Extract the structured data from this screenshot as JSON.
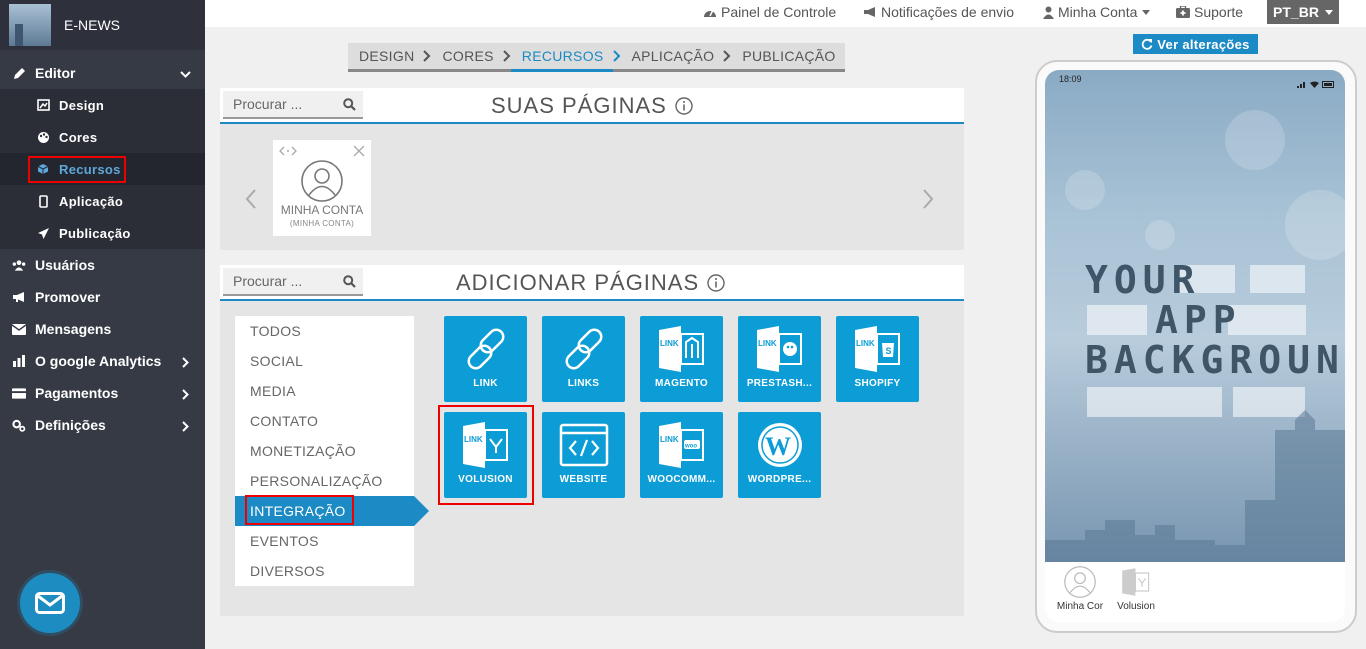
{
  "app": {
    "name": "E-NEWS"
  },
  "sidebar": {
    "items": [
      {
        "label": "Editor"
      },
      {
        "label": "Usuários"
      },
      {
        "label": "Promover"
      },
      {
        "label": "Mensagens"
      },
      {
        "label": "O google Analytics"
      },
      {
        "label": "Pagamentos"
      },
      {
        "label": "Definições"
      }
    ],
    "editor_subitems": [
      {
        "label": "Design"
      },
      {
        "label": "Cores"
      },
      {
        "label": "Recursos"
      },
      {
        "label": "Aplicação"
      },
      {
        "label": "Publicação"
      }
    ],
    "active_subitem": "Recursos"
  },
  "topbar": {
    "dashboard": "Painel de Controle",
    "notifications": "Notificações de envio",
    "account": "Minha Conta",
    "support": "Suporte",
    "language": "PT_BR"
  },
  "steps": [
    "DESIGN",
    "CORES",
    "RECURSOS",
    "APLICAÇÃO",
    "PUBLICAÇÃO"
  ],
  "active_step": "RECURSOS",
  "your_pages": {
    "search_placeholder": "Procurar ...",
    "title": "SUAS PÁGINAS",
    "pages": [
      {
        "title": "MINHA CONTA",
        "subtitle": "(MINHA CONTA)"
      }
    ]
  },
  "add_pages": {
    "search_placeholder": "Procurar ...",
    "title": "ADICIONAR PÁGINAS",
    "categories": [
      "TODOS",
      "SOCIAL",
      "MEDIA",
      "CONTATO",
      "MONETIZAÇÃO",
      "PERSONALIZAÇÃO",
      "INTEGRAÇÃO",
      "EVENTOS",
      "DIVERSOS"
    ],
    "active_category": "INTEGRAÇÃO",
    "tiles": [
      {
        "label": "LINK",
        "icon": "chain-link-icon"
      },
      {
        "label": "LINKS",
        "icon": "chain-link-icon"
      },
      {
        "label": "MAGENTO",
        "icon": "magento-icon"
      },
      {
        "label": "PRESTASH...",
        "icon": "prestashop-icon"
      },
      {
        "label": "SHOPIFY",
        "icon": "shopify-icon"
      },
      {
        "label": "VOLUSION",
        "icon": "volusion-icon"
      },
      {
        "label": "WEBSITE",
        "icon": "code-window-icon"
      },
      {
        "label": "WOOCOMM...",
        "icon": "woocommerce-icon"
      },
      {
        "label": "WORDPRE...",
        "icon": "wordpress-icon"
      }
    ],
    "highlighted_tile": "VOLUSION"
  },
  "preview": {
    "button_label": "Ver alterações",
    "time": "18:09",
    "bg_lines": [
      "YOUR",
      "APP",
      "BACKGROUND"
    ],
    "tabs": [
      {
        "label": "Minha Cor"
      },
      {
        "label": "Volusion"
      }
    ]
  },
  "colors": {
    "accent": "#1c8ac4",
    "tile": "#0d9dd6",
    "sidebar": "#363a45",
    "highlight": "#e00000"
  }
}
